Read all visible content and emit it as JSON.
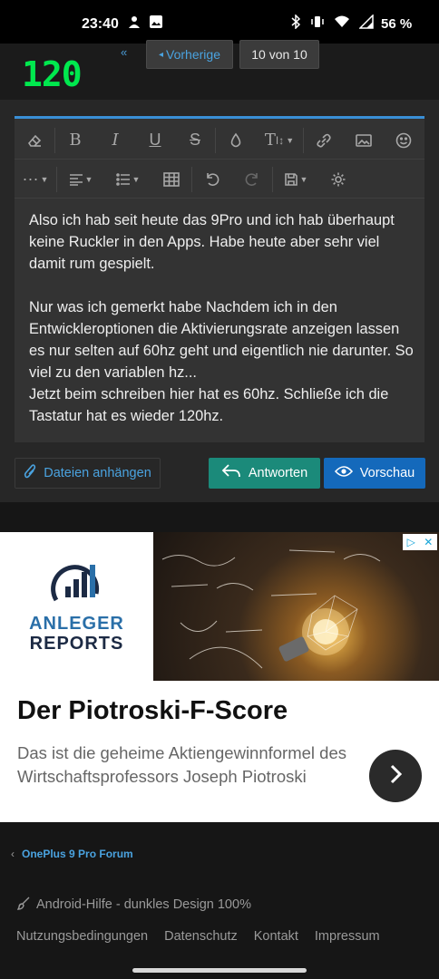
{
  "status_bar": {
    "time": "23:40",
    "battery": "56 %",
    "icons_left": [
      "sync-icon",
      "image-icon"
    ],
    "icons_right": [
      "bluetooth-icon",
      "vibrate-icon",
      "wifi-icon",
      "signal-icon"
    ]
  },
  "overlay": {
    "refresh_rate": "120",
    "refresh_color": "#00e84e"
  },
  "pagination": {
    "first_label": "«",
    "prev_label": "Vorherige",
    "count_label": "10 von 10"
  },
  "editor": {
    "toolbar_row1": [
      "eraser-icon",
      "bold-icon",
      "italic-icon",
      "underline-icon",
      "strikethrough-icon",
      "color-icon",
      "font-size-icon",
      "link-icon",
      "image-icon",
      "smiley-icon"
    ],
    "toolbar_row2": [
      "more-icon",
      "align-icon",
      "list-icon",
      "table-icon",
      "undo-icon",
      "redo-icon",
      "save-icon",
      "settings-icon"
    ],
    "paragraphs": [
      "Also ich hab seit heute das 9Pro und ich hab überhaupt keine Ruckler in den Apps. Habe heute aber sehr viel damit rum gespielt.",
      "Nur was ich gemerkt habe Nachdem ich in den Entwickleroptionen die Aktivierungsrate anzeigen lassen es nur selten auf 60hz geht und eigentlich nie darunter. So viel zu den variablen hz...\nJetzt beim schreiben hier hat es 60hz. Schließe ich die Tastatur hat es wieder 120hz."
    ]
  },
  "actions": {
    "attach_label": "Dateien anhängen",
    "reply_label": "Antworten",
    "preview_label": "Vorschau",
    "reply_color": "#1b8a7a",
    "preview_color": "#1469bb"
  },
  "ad": {
    "logo_line1": "ANLEGER",
    "logo_line2": "REPORTS",
    "title": "Der Piotroski-F-Score",
    "description": "Das ist die geheime Aktiengewinnformel des Wirtschaftsprofessors Joseph Piotroski"
  },
  "footer": {
    "breadcrumb": "OnePlus 9 Pro Forum",
    "style_label": "Android-Hilfe - dunkles Design 100%",
    "links": [
      "Nutzungsbedingungen",
      "Datenschutz",
      "Kontakt",
      "Impressum"
    ]
  }
}
